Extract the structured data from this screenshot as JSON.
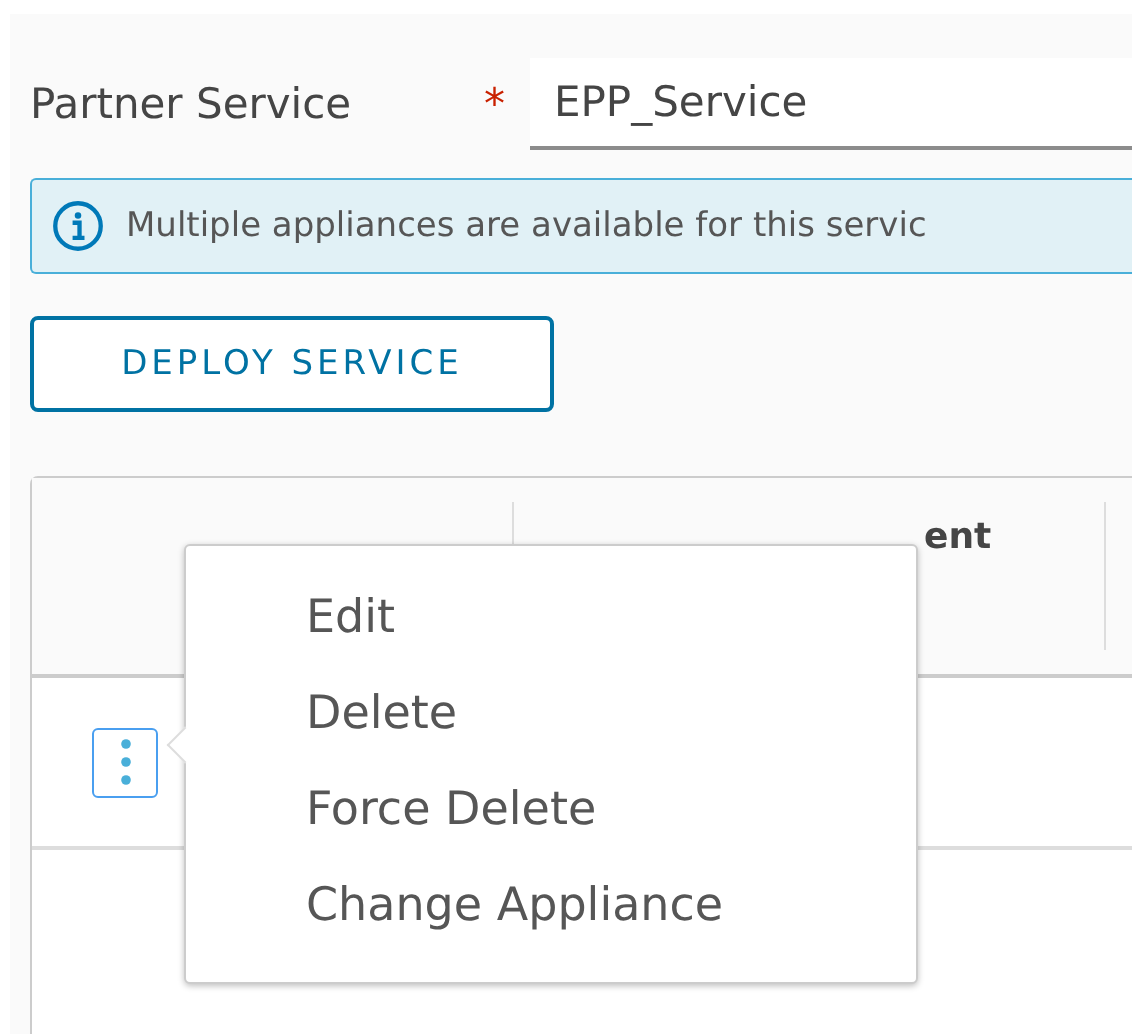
{
  "form": {
    "label": "Partner Service",
    "required_mark": "*",
    "value": "EPP_Service"
  },
  "alert": {
    "text": "Multiple appliances are available for this servic"
  },
  "deploy_button": {
    "label": "DEPLOY SERVICE"
  },
  "table": {
    "columns": [
      {
        "label": "ent"
      }
    ]
  },
  "menu": {
    "items": [
      {
        "label": "Edit"
      },
      {
        "label": "Delete"
      },
      {
        "label": "Force Delete"
      },
      {
        "label": "Change Appliance"
      }
    ]
  }
}
